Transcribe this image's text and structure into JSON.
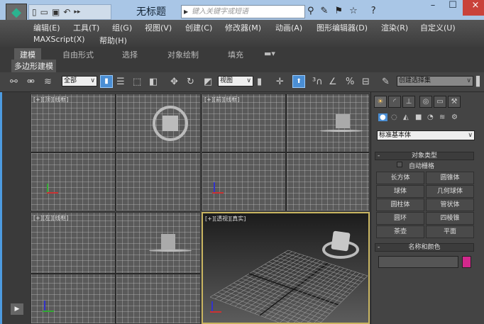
{
  "window": {
    "title": "无标题",
    "search_placeholder": "键入关键字或短语",
    "close": "×",
    "minimize": "–",
    "maximize": "☐"
  },
  "menu": [
    "编辑(E)",
    "工具(T)",
    "组(G)",
    "视图(V)",
    "创建(C)",
    "修改器(M)",
    "动画(A)",
    "图形编辑器(D)",
    "渲染(R)",
    "自定义(U)",
    "MAXScript(X)",
    "帮助(H)"
  ],
  "ribbon": {
    "tabs": [
      "建模",
      "自由形式",
      "选择",
      "对象绘制",
      "填充"
    ],
    "subtab": "多边形建模"
  },
  "toolbar": {
    "filter": "全部",
    "coord": "视图",
    "selection_set": "创建选择集"
  },
  "viewports": {
    "top": "[+][顶][线框]",
    "front": "[+][前][线框]",
    "left": "[+][左][线框]",
    "perspective": "[+][透视][真实]"
  },
  "command_panel": {
    "category": "标准基本体",
    "object_type_title": "对象类型",
    "autogrid": "自动栅格",
    "objects": [
      "长方体",
      "圆锥体",
      "球体",
      "几何球体",
      "圆柱体",
      "管状体",
      "圆环",
      "四棱锥",
      "茶壶",
      "平面"
    ],
    "name_color_title": "名称和颜色",
    "object_color": "#d2288c"
  }
}
